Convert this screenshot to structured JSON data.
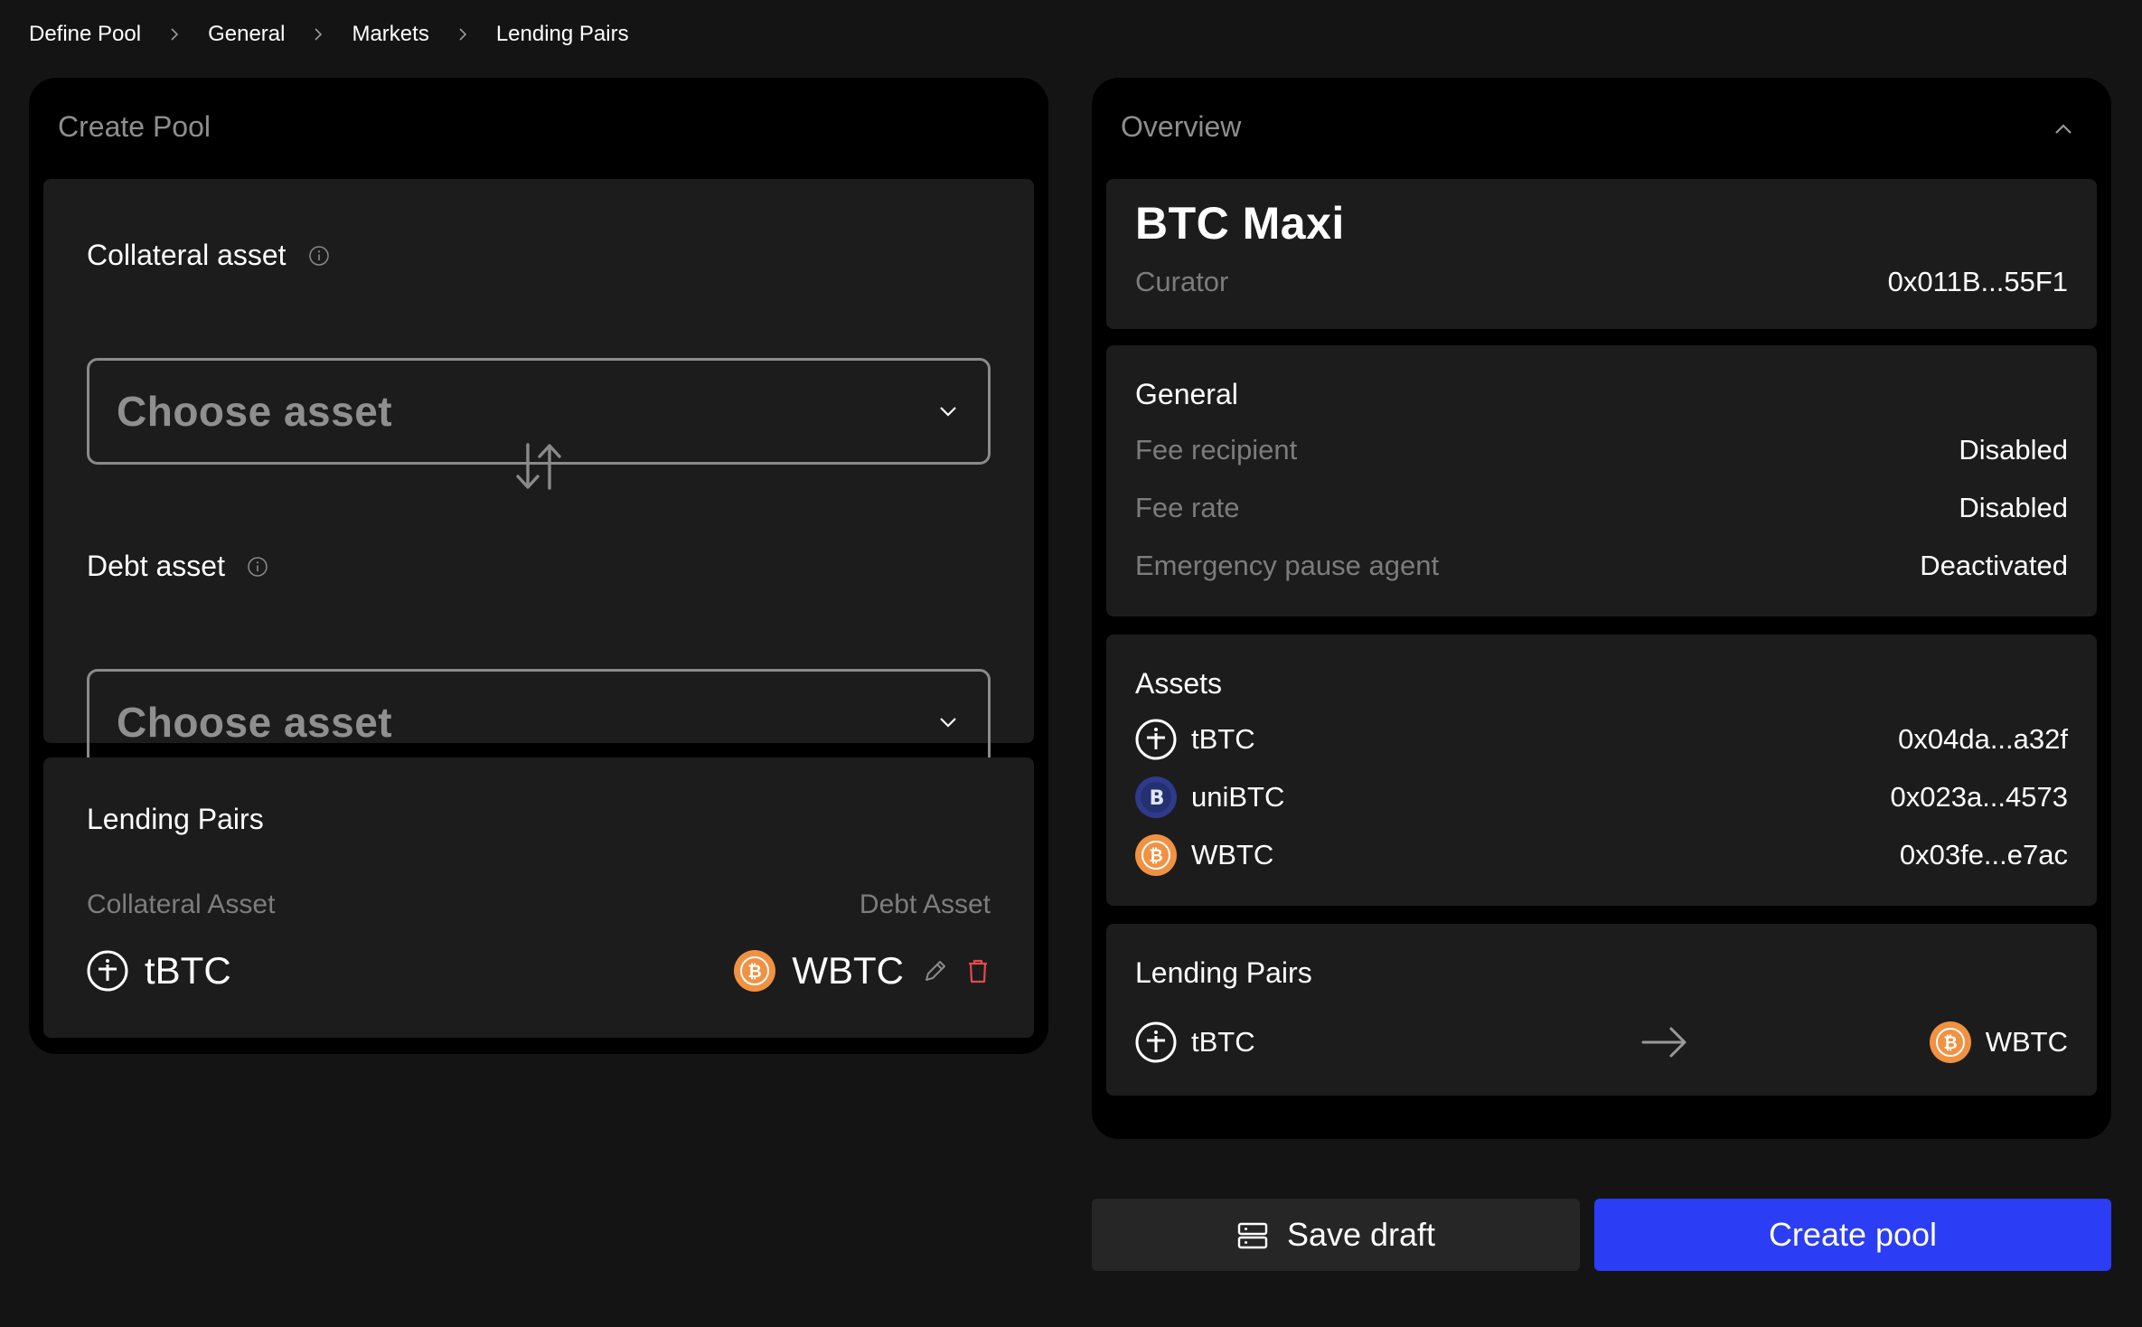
{
  "breadcrumb": [
    "Define Pool",
    "General",
    "Markets",
    "Lending Pairs"
  ],
  "create_pool": {
    "title": "Create Pool",
    "collateral_label": "Collateral asset",
    "collateral_placeholder": "Choose asset",
    "debt_label": "Debt asset",
    "debt_placeholder": "Choose asset"
  },
  "lending_pairs_editor": {
    "title": "Lending Pairs",
    "col_collateral": "Collateral Asset",
    "col_debt": "Debt Asset",
    "pairs": [
      {
        "collateral": "tBTC",
        "debt": "WBTC"
      }
    ]
  },
  "overview": {
    "title": "Overview",
    "pool_name": "BTC Maxi",
    "curator_label": "Curator",
    "curator_value": "0x011B...55F1",
    "general": {
      "title": "General",
      "rows": [
        {
          "label": "Fee recipient",
          "value": "Disabled"
        },
        {
          "label": "Fee rate",
          "value": "Disabled"
        },
        {
          "label": "Emergency pause agent",
          "value": "Deactivated"
        }
      ]
    },
    "assets": {
      "title": "Assets",
      "items": [
        {
          "name": "tBTC",
          "address": "0x04da...a32f",
          "icon": "tbtc-icon"
        },
        {
          "name": "uniBTC",
          "address": "0x023a...4573",
          "icon": "unibtc-icon"
        },
        {
          "name": "WBTC",
          "address": "0x03fe...e7ac",
          "icon": "wbtc-icon"
        }
      ]
    },
    "lending_pairs": {
      "title": "Lending Pairs",
      "collateral": "tBTC",
      "debt": "WBTC"
    }
  },
  "buttons": {
    "save_draft": "Save draft",
    "create_pool": "Create pool"
  },
  "colors": {
    "background": "#141414",
    "panel": "#000000",
    "card": "#1c1c1c",
    "primary": "#2b3df5",
    "muted": "#7c7c7c",
    "wbtc_orange": "#f09242",
    "delete_red": "#e5484d"
  }
}
